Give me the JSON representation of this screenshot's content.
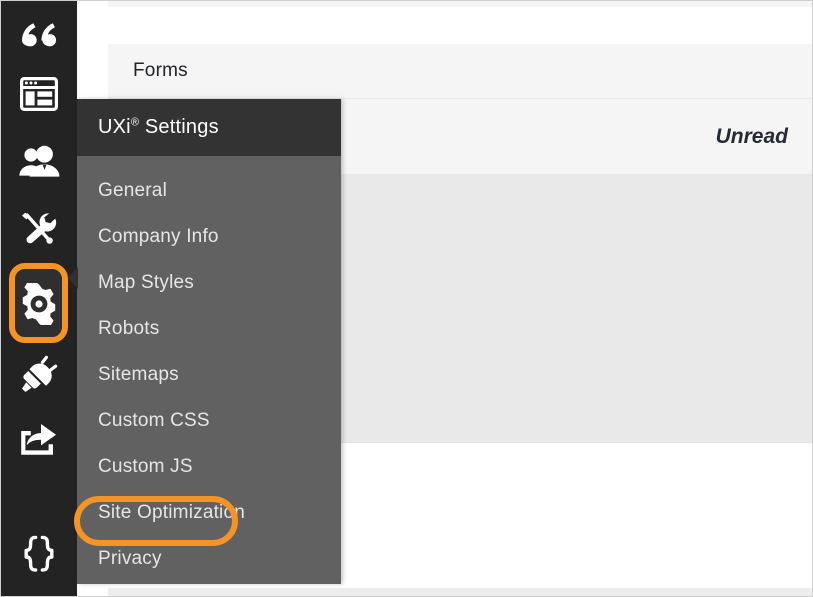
{
  "app": {
    "accent_color": "#f59425",
    "rail_background": "#232323",
    "panel_background": "#616161",
    "panel_header_background": "#333333"
  },
  "rail": {
    "items": [
      {
        "name": "quotes-icon",
        "label": "Quotes"
      },
      {
        "name": "pages-icon",
        "label": "Pages"
      },
      {
        "name": "users-icon",
        "label": "Users"
      },
      {
        "name": "tools-icon",
        "label": "Tools"
      },
      {
        "name": "gear-icon",
        "label": "Settings"
      },
      {
        "name": "plug-icon",
        "label": "Integrations"
      },
      {
        "name": "share-icon",
        "label": "Publish"
      },
      {
        "name": "braces-icon",
        "label": "Code"
      }
    ],
    "selected": "gear-icon"
  },
  "content": {
    "forms_title": "Forms",
    "unread_label": "Unread"
  },
  "flyout": {
    "title_main": "UXi",
    "title_sup": "®",
    "title_suffix": " Settings",
    "selected": "Custom JS",
    "items": [
      {
        "label": "General"
      },
      {
        "label": "Company Info"
      },
      {
        "label": "Map Styles"
      },
      {
        "label": "Robots"
      },
      {
        "label": "Sitemaps"
      },
      {
        "label": "Custom CSS"
      },
      {
        "label": "Custom JS"
      },
      {
        "label": "Site Optimization"
      },
      {
        "label": "Privacy"
      }
    ]
  }
}
